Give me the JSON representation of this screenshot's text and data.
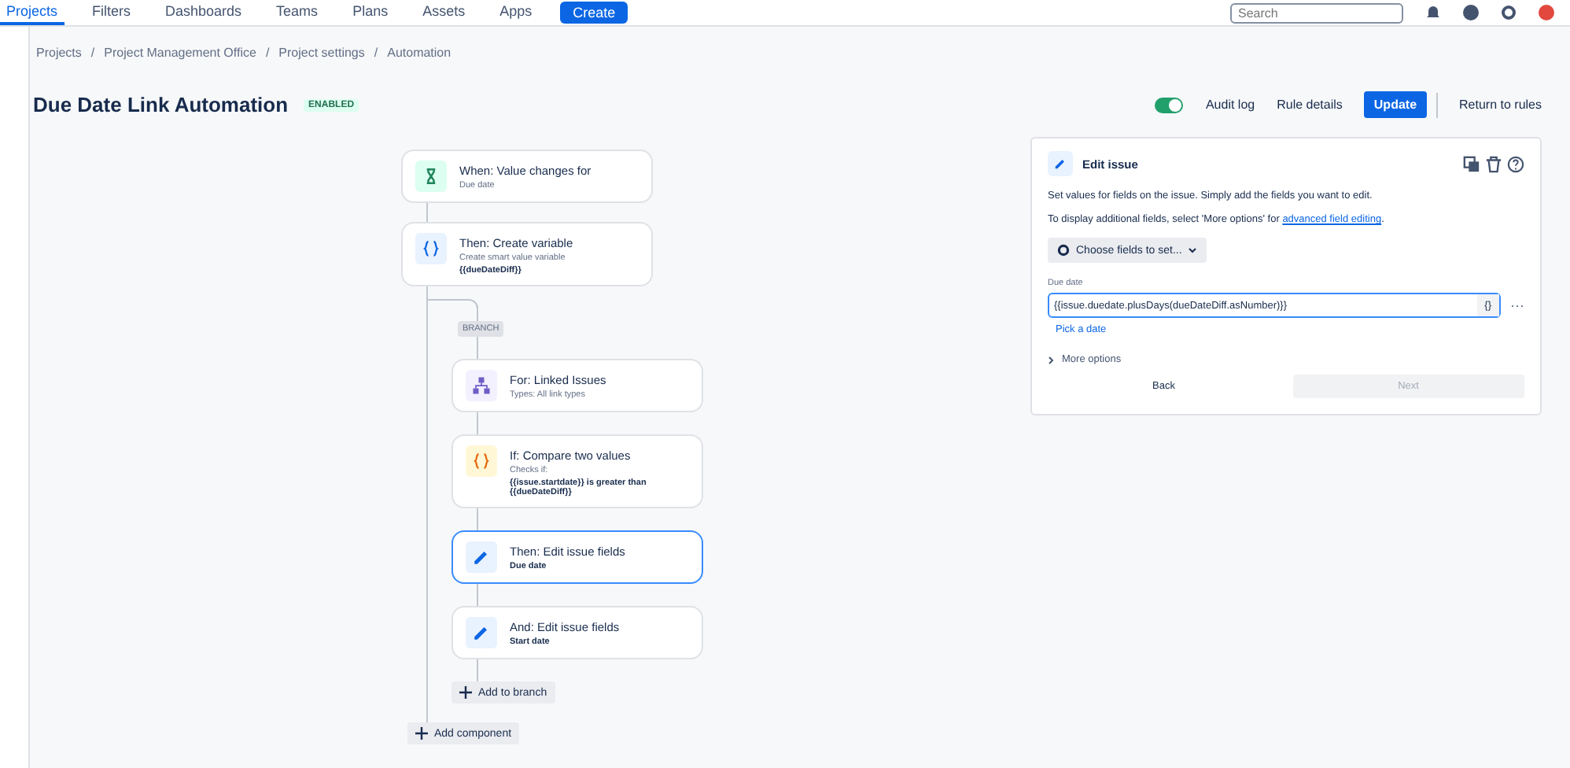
{
  "nav": {
    "items": [
      {
        "label": "Projects",
        "selected": true
      },
      {
        "label": "Filters",
        "selected": false
      },
      {
        "label": "Dashboards",
        "selected": false
      },
      {
        "label": "Teams",
        "selected": false
      },
      {
        "label": "Plans",
        "selected": false
      },
      {
        "label": "Assets",
        "selected": false
      },
      {
        "label": "Apps",
        "selected": false
      }
    ],
    "create": "Create",
    "search": {
      "placeholder": "Search"
    }
  },
  "breadcrumbs": [
    "Projects",
    "Project Management Office",
    "Project settings",
    "Automation"
  ],
  "breadcrumb_separator": "/",
  "rule": {
    "title": "Due Date Link Automation",
    "status": "ENABLED",
    "on": true
  },
  "actions": {
    "audit_log": "Audit log",
    "rule_details": "Rule details",
    "update": "Update",
    "return": "Return to rules"
  },
  "flow": {
    "nodes": [
      {
        "kind": "trigger",
        "title": "When: Value changes for",
        "selected": false,
        "lines": [
          {
            "text": "Due date",
            "strong": false
          }
        ]
      },
      {
        "kind": "variable",
        "title": "Then: Create variable",
        "selected": false,
        "lines": [
          {
            "text": "Create smart value variable",
            "strong": false
          },
          {
            "text": "{{dueDateDiff}}",
            "strong": true
          }
        ]
      }
    ],
    "branch": {
      "label": "BRANCH",
      "nodes": [
        {
          "kind": "branch",
          "title": "For: Linked Issues",
          "selected": false,
          "lines": [
            {
              "text": "Types: All link types",
              "strong": false
            }
          ]
        },
        {
          "kind": "condition",
          "title": "If: Compare two values",
          "selected": false,
          "lines": [
            {
              "text": "Checks if:",
              "strong": false
            },
            {
              "text": "{{issue.startdate}} is greater than {{dueDateDiff}}",
              "strong": true
            }
          ]
        },
        {
          "kind": "edit",
          "title": "Then: Edit issue fields",
          "selected": true,
          "lines": [
            {
              "text": "Due date",
              "strong": true
            }
          ]
        },
        {
          "kind": "edit",
          "title": "And: Edit issue fields",
          "selected": false,
          "lines": [
            {
              "text": "Start date",
              "strong": true
            }
          ]
        }
      ],
      "add": "Add to branch"
    },
    "add": "Add component"
  },
  "panel": {
    "title": "Edit issue",
    "description": "Set values for fields on the issue. Simply add the fields you want to edit.",
    "hint": "To display additional fields, select 'More options' for",
    "hint_link": "advanced field editing",
    "hint_end": ".",
    "choose": "Choose fields to set...",
    "field_label": "Due date",
    "field_value": "{{issue.duedate.plusDays(dueDateDiff.asNumber)}}",
    "smart_button": "{}",
    "more": "···",
    "pick_date": "Pick a date",
    "more_options": "More options",
    "back": "Back",
    "next": "Next"
  }
}
